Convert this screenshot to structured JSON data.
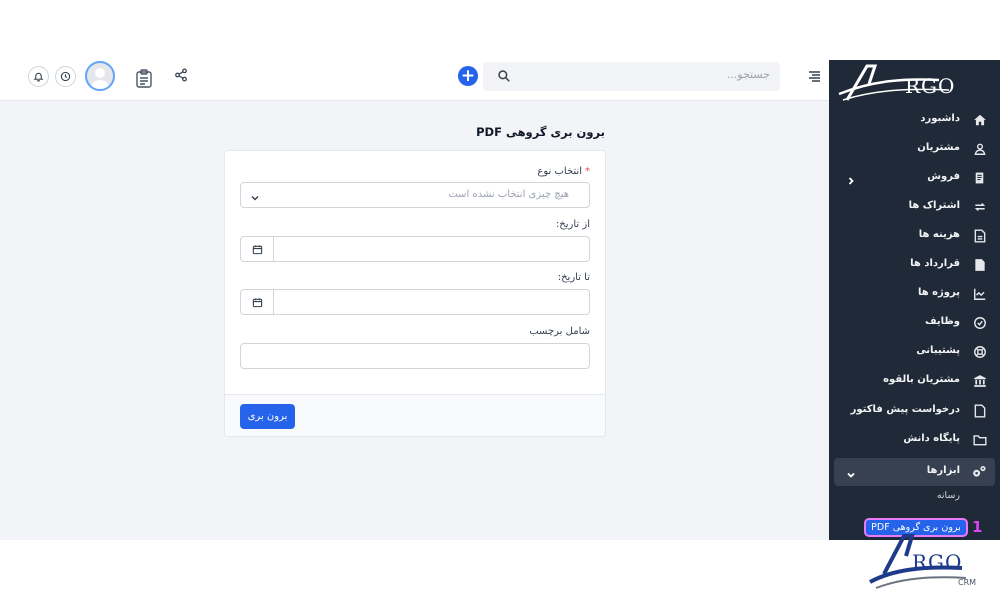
{
  "header": {
    "search_placeholder": "جستجو...",
    "icons": [
      "bell-icon",
      "clock-icon",
      "avatar",
      "clipboard-icon",
      "share-icon",
      "plus-icon",
      "search-icon",
      "menu-toggle-icon"
    ]
  },
  "sidebar": {
    "logo_text": "RGO",
    "items": [
      {
        "label": "داشبورد",
        "icon": "home-icon"
      },
      {
        "label": "مشتریان",
        "icon": "user-icon"
      },
      {
        "label": "فروش",
        "icon": "document-icon"
      },
      {
        "label": "اشتراک ها",
        "icon": "refresh-icon"
      },
      {
        "label": "هزینه ها",
        "icon": "file-icon"
      },
      {
        "label": "قرارداد ها",
        "icon": "contract-icon"
      },
      {
        "label": "پروژه ها",
        "icon": "chart-icon"
      },
      {
        "label": "وظایف",
        "icon": "check-circle-icon"
      },
      {
        "label": "پشتیبانی",
        "icon": "lifebuoy-icon"
      },
      {
        "label": "مشتریان بالقوه",
        "icon": "bank-icon"
      },
      {
        "label": "درخواست پیش فاکتور",
        "icon": "file-icon"
      },
      {
        "label": "پایگاه دانش",
        "icon": "folder-icon"
      },
      {
        "label": "ابزارها",
        "icon": "cogs-icon"
      }
    ],
    "sub_items": [
      "رسانه",
      "برون بری گروهی PDF"
    ],
    "marker": "1"
  },
  "main": {
    "title": "برون بری گروهی PDF",
    "form": {
      "type_label": "انتخاب نوع",
      "type_required": "*",
      "type_value": "هیچ چیزی انتخاب نشده است",
      "from_label": "از تاریخ:",
      "to_label": "تا تاریخ:",
      "tag_label": "شامل برچسب",
      "submit_label": "برون بری"
    }
  },
  "branding": {
    "logo_text": "RGO",
    "logo_sub": "CRM"
  },
  "colors": {
    "accent": "#2563eb",
    "sidebar_bg": "#1f2937",
    "content_bg": "#f2f4f7",
    "highlight_border": "#e879f9"
  }
}
